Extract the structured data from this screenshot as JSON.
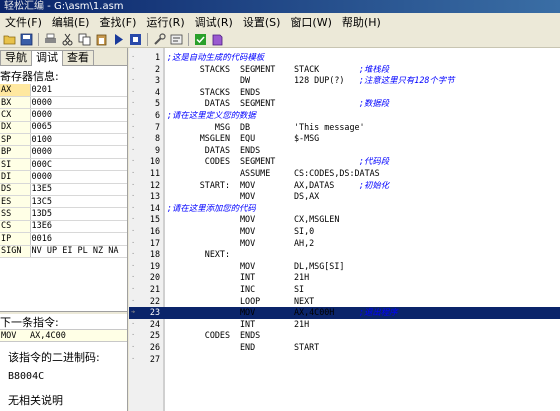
{
  "window": {
    "app": "轻松汇编",
    "path": " - G:\\asm\\1.asm"
  },
  "menu": [
    "文件(F)",
    "编辑(E)",
    "查找(F)",
    "运行(R)",
    "调试(R)",
    "设置(S)",
    "窗口(W)",
    "帮助(H)"
  ],
  "toolbar": {
    "icons": [
      "open-icon",
      "save-icon",
      "print-icon",
      "cut-icon",
      "copy-icon",
      "paste-icon",
      "run-icon",
      "debug-icon",
      "tools-icon",
      "settings-icon",
      "check-icon",
      "book-icon"
    ]
  },
  "left": {
    "tabs": [
      "导航",
      "调试",
      "查看"
    ],
    "active_tab": "调试",
    "register_title": "寄存器信息:",
    "registers": [
      {
        "name": "AX",
        "value": "0201"
      },
      {
        "name": "BX",
        "value": "0000"
      },
      {
        "name": "CX",
        "value": "0000"
      },
      {
        "name": "DX",
        "value": "0065"
      },
      {
        "name": "SP",
        "value": "0100"
      },
      {
        "name": "BP",
        "value": "0000"
      },
      {
        "name": "SI",
        "value": "000C"
      },
      {
        "name": "DI",
        "value": "0000"
      },
      {
        "name": "DS",
        "value": "13E5"
      },
      {
        "name": "ES",
        "value": "13C5"
      },
      {
        "name": "SS",
        "value": "13D5"
      },
      {
        "name": "CS",
        "value": "13E6"
      },
      {
        "name": "IP",
        "value": "0016"
      },
      {
        "name": "SIGN",
        "value": "NV UP EI PL NZ NA"
      }
    ],
    "next_title": "下一条指令:",
    "next_op": "MOV",
    "next_args": "AX,4C00",
    "binary_title": "该指令的二进制码:",
    "binary_value": "B8004C",
    "description": "无相关说明"
  },
  "editor": {
    "lines": [
      {
        "n": "1",
        "a": "",
        "b": "",
        "c": "",
        "cm": ";这是自动生成的代码模板"
      },
      {
        "n": "2",
        "a": "STACKS",
        "b": "SEGMENT",
        "c": "STACK",
        "cm": ";堆栈段"
      },
      {
        "n": "3",
        "a": "",
        "b": "DW",
        "c": "128 DUP(?)",
        "cm": ";注意这里只有128个字节"
      },
      {
        "n": "4",
        "a": "STACKS",
        "b": "ENDS",
        "c": "",
        "cm": ""
      },
      {
        "n": "5",
        "a": "DATAS",
        "b": "SEGMENT",
        "c": "",
        "cm": ";数据段"
      },
      {
        "n": "6",
        "a": "",
        "b": "",
        "c": "",
        "cm": ";请在这里定义您的数据"
      },
      {
        "n": "7",
        "a": "MSG",
        "b": "DB",
        "c": "'This message'",
        "cm": ""
      },
      {
        "n": "8",
        "a": "MSGLEN",
        "b": "EQU",
        "c": "$-MSG",
        "cm": ""
      },
      {
        "n": "9",
        "a": "DATAS",
        "b": "ENDS",
        "c": "",
        "cm": ""
      },
      {
        "n": "10",
        "a": "CODES",
        "b": "SEGMENT",
        "c": "",
        "cm": ";代码段"
      },
      {
        "n": "11",
        "a": "",
        "b": "ASSUME",
        "c": "CS:CODES,DS:DATAS",
        "cm": ""
      },
      {
        "n": "12",
        "a": "START:",
        "b": "MOV",
        "c": "AX,DATAS",
        "cm": ";初始化"
      },
      {
        "n": "13",
        "a": "",
        "b": "MOV",
        "c": "DS,AX",
        "cm": ""
      },
      {
        "n": "14",
        "a": "",
        "b": "",
        "c": "",
        "cm": ";请在这里添加您的代码"
      },
      {
        "n": "15",
        "a": "",
        "b": "MOV",
        "c": "CX,MSGLEN",
        "cm": ""
      },
      {
        "n": "16",
        "a": "",
        "b": "MOV",
        "c": "SI,0",
        "cm": ""
      },
      {
        "n": "17",
        "a": "",
        "b": "MOV",
        "c": "AH,2",
        "cm": ""
      },
      {
        "n": "18",
        "a": "NEXT:",
        "b": "",
        "c": "",
        "cm": ""
      },
      {
        "n": "19",
        "a": "",
        "b": "MOV",
        "c": "DL,MSG[SI]",
        "cm": ""
      },
      {
        "n": "20",
        "a": "",
        "b": "INT",
        "c": "21H",
        "cm": ""
      },
      {
        "n": "21",
        "a": "",
        "b": "INC",
        "c": "SI",
        "cm": ""
      },
      {
        "n": "22",
        "a": "",
        "b": "LOOP",
        "c": "NEXT",
        "cm": ""
      },
      {
        "n": "23",
        "a": "",
        "b": "MOV",
        "c": "AX,4C00H",
        "cm": ";退出程序"
      },
      {
        "n": "24",
        "a": "",
        "b": "INT",
        "c": "21H",
        "cm": ""
      },
      {
        "n": "25",
        "a": "CODES",
        "b": "ENDS",
        "c": "",
        "cm": ""
      },
      {
        "n": "26",
        "a": "",
        "b": "END",
        "c": "START",
        "cm": ""
      },
      {
        "n": "27",
        "a": "",
        "b": "",
        "c": "",
        "cm": ""
      }
    ],
    "highlight_line": "23"
  }
}
